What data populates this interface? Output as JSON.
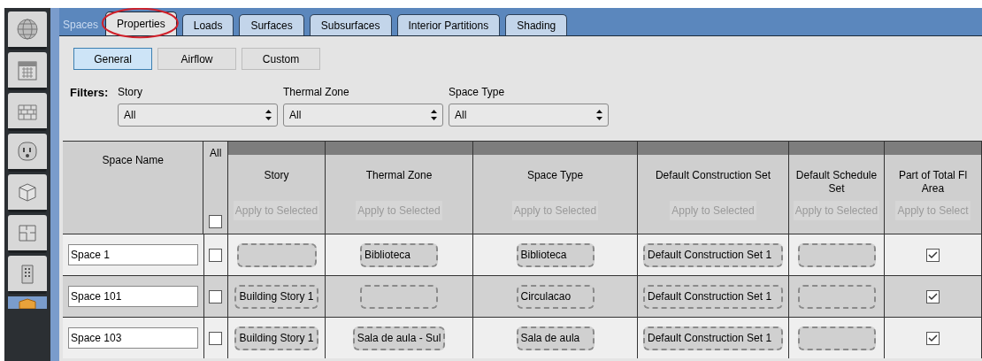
{
  "side_tab": "Spaces",
  "tabs": [
    {
      "label": "Properties",
      "selected": true,
      "circled": true
    },
    {
      "label": "Loads",
      "selected": false,
      "circled": false
    },
    {
      "label": "Surfaces",
      "selected": false,
      "circled": false
    },
    {
      "label": "Subsurfaces",
      "selected": false,
      "circled": false
    },
    {
      "label": "Interior Partitions",
      "selected": false,
      "circled": false
    },
    {
      "label": "Shading",
      "selected": false,
      "circled": false
    }
  ],
  "subtabs": [
    {
      "label": "General",
      "selected": true
    },
    {
      "label": "Airflow",
      "selected": false
    },
    {
      "label": "Custom",
      "selected": false
    }
  ],
  "filters": {
    "label": "Filters:",
    "items": [
      {
        "label": "Story",
        "value": "All"
      },
      {
        "label": "Thermal Zone",
        "value": "All"
      },
      {
        "label": "Space Type",
        "value": "All"
      }
    ]
  },
  "table": {
    "name_column": "Space Name",
    "select_all": {
      "label": "All",
      "checked": false
    },
    "columns": [
      {
        "title": "Story",
        "apply": "Apply to Selected",
        "kind": "drop"
      },
      {
        "title": "Thermal Zone",
        "apply": "Apply to Selected",
        "kind": "drop"
      },
      {
        "title": "Space Type",
        "apply": "Apply to Selected",
        "kind": "drop"
      },
      {
        "title": "Default Construction Set",
        "apply": "Apply to Selected",
        "kind": "drop"
      },
      {
        "title": "Default Schedule Set",
        "apply": "Apply to Selected",
        "kind": "drop"
      },
      {
        "title": "Part of Total Fl\nArea",
        "apply": "Apply to Select",
        "kind": "check"
      }
    ],
    "rows": [
      {
        "name": "Space 1",
        "selected": false,
        "cells": [
          {},
          {
            "value": "Biblioteca"
          },
          {
            "value": "Biblioteca"
          },
          {
            "value": "Default Construction Set 1"
          },
          {},
          {
            "checked": true
          }
        ]
      },
      {
        "name": "Space 101",
        "selected": false,
        "cells": [
          {
            "value": "Building Story 1"
          },
          {},
          {
            "value": "Circulacao"
          },
          {
            "value": "Default Construction Set 1"
          },
          {},
          {
            "checked": true
          }
        ]
      },
      {
        "name": "Space 103",
        "selected": false,
        "cells": [
          {
            "value": "Building Story 1"
          },
          {
            "value": "Sala de aula - Sul"
          },
          {
            "value": "Sala de aula"
          },
          {
            "value": "Default Construction Set 1"
          },
          {},
          {
            "checked": true
          }
        ]
      }
    ]
  }
}
